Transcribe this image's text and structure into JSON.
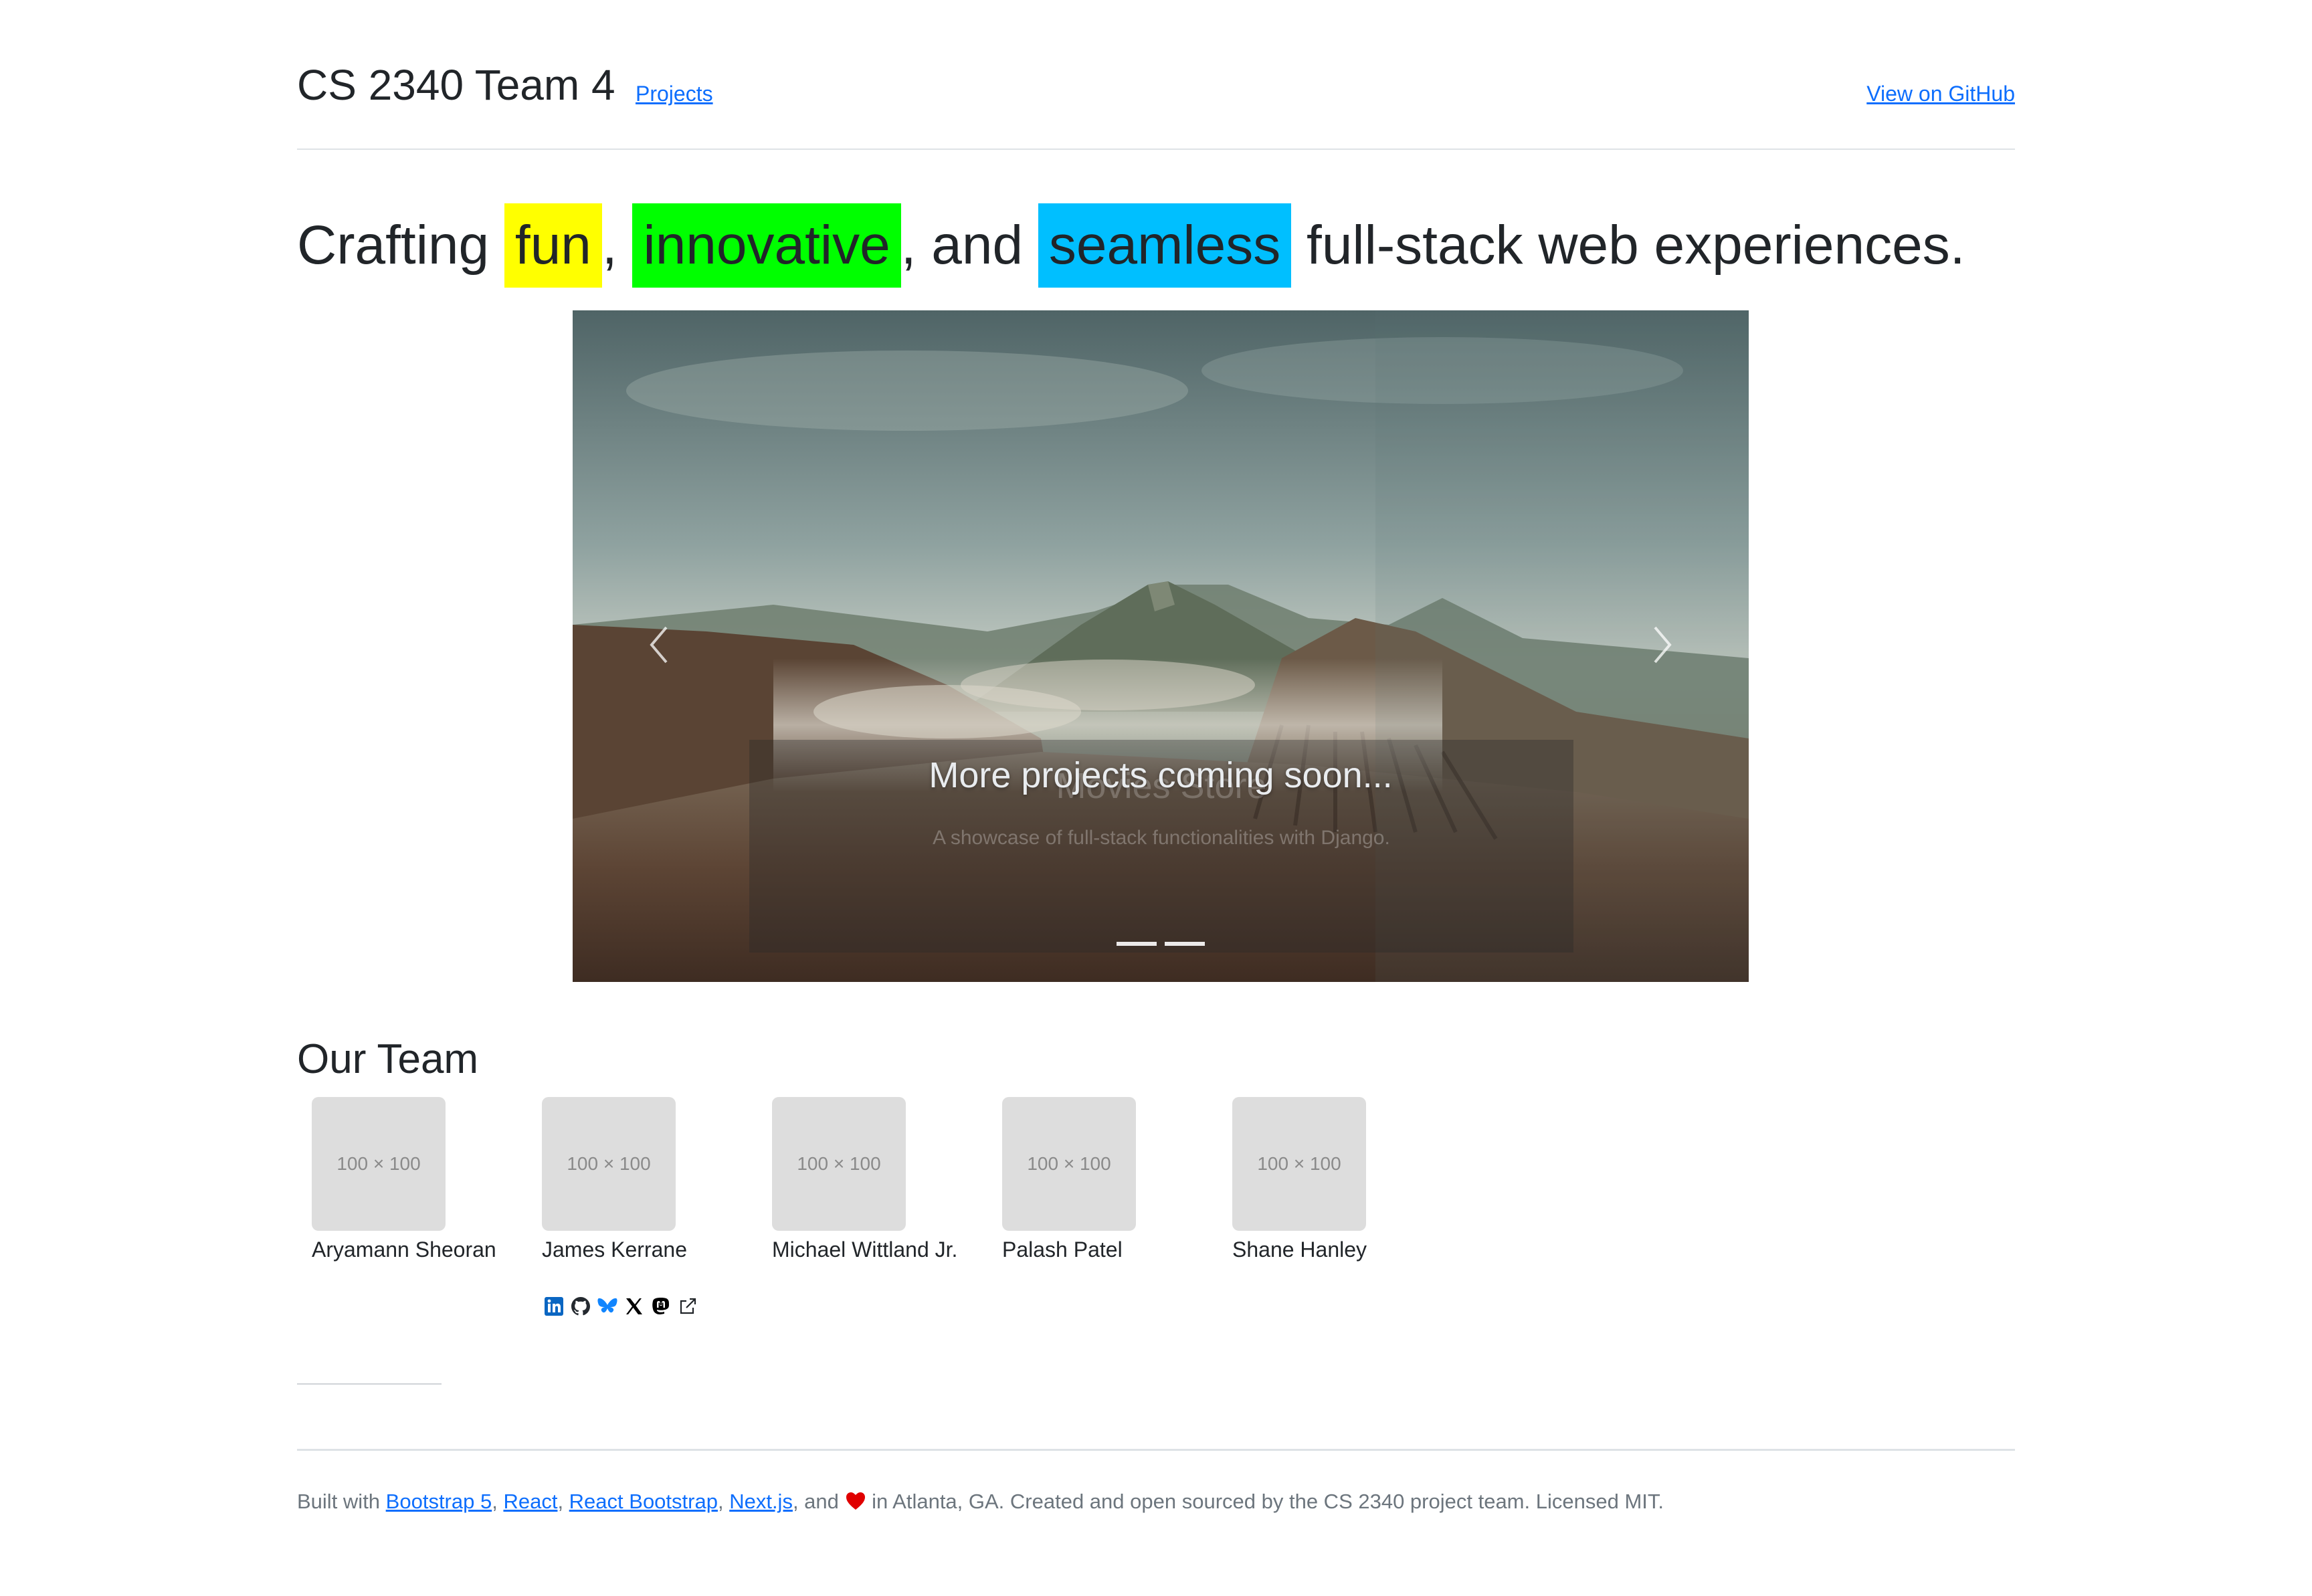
{
  "header": {
    "brand": "CS 2340 Team 4",
    "nav_projects": "Projects",
    "github_link": "View on GitHub"
  },
  "hero": {
    "part1": "Crafting ",
    "word1": "fun",
    "part2": ", ",
    "word2": "innovative",
    "part3": ", and ",
    "word3": "seamless",
    "part4": " full-stack web experiences.",
    "colors": {
      "fun": "#ffff00",
      "innovative": "#00ff00",
      "seamless": "#00bfff"
    }
  },
  "carousel": {
    "ghost_title": "Movies Store",
    "ghost_subtitle": "A showcase of full-stack functionalities with Django.",
    "caption": "More projects coming soon...",
    "indicator_count": 2,
    "prev_icon": "chevron-left-icon",
    "next_icon": "chevron-right-icon"
  },
  "team": {
    "heading": "Our Team",
    "placeholder": "100 × 100",
    "members": [
      {
        "name": "Aryamann Sheoran"
      },
      {
        "name": "James Kerrane"
      },
      {
        "name": "Michael Wittland Jr."
      },
      {
        "name": "Palash Patel"
      },
      {
        "name": "Shane Hanley"
      }
    ],
    "social_icons": [
      "linkedin-icon",
      "github-icon",
      "bluesky-icon",
      "x-icon",
      "mastodon-icon",
      "external-link-icon"
    ]
  },
  "footer": {
    "built_with": "Built with ",
    "links": [
      "Bootstrap 5",
      "React",
      "React Bootstrap",
      "Next.js"
    ],
    "sep": ", ",
    "and": ", and ",
    "tail": " in Atlanta, GA. Created and open sourced by the CS 2340 project team. Licensed MIT.",
    "heart_color": "#e00000"
  }
}
